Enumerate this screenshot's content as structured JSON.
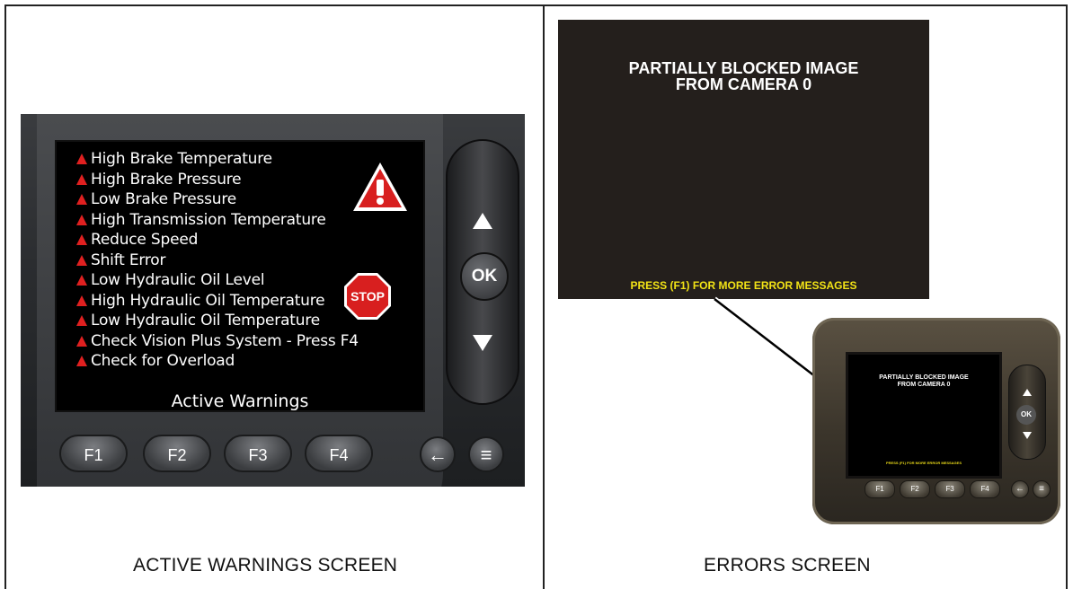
{
  "left_panel": {
    "caption": "ACTIVE WARNINGS SCREEN",
    "screen": {
      "warnings": [
        "High Brake Temperature",
        "High Brake Pressure",
        "Low Brake Pressure",
        "High Transmission Temperature",
        "Reduce Speed",
        "Shift Error",
        "Low Hydraulic Oil Level",
        "High Hydraulic Oil Temperature",
        "Low Hydraulic Oil Temperature",
        "Check Vision Plus System - Press F4",
        "Check for Overload"
      ],
      "title": "Active Warnings",
      "stop_label": "STOP"
    },
    "nav": {
      "ok_label": "OK"
    },
    "function_keys": [
      "F1",
      "F2",
      "F3",
      "F4"
    ]
  },
  "right_panel": {
    "caption": "ERRORS SCREEN",
    "zoom_screen": {
      "title_line1": "PARTIALLY BLOCKED IMAGE",
      "title_line2": "FROM CAMERA 0",
      "footer": "PRESS (F1)  FOR MORE ERROR MESSAGES"
    },
    "device": {
      "title_line1": "PARTIALLY BLOCKED IMAGE",
      "title_line2": "FROM CAMERA 0",
      "footer": "PRESS (F1)  FOR MORE ERROR MESSAGES",
      "ok_label": "OK",
      "function_keys": [
        "F1",
        "F2",
        "F3",
        "F4"
      ]
    }
  },
  "colors": {
    "warning_red": "#e02020",
    "footer_yellow": "#f2e316"
  }
}
